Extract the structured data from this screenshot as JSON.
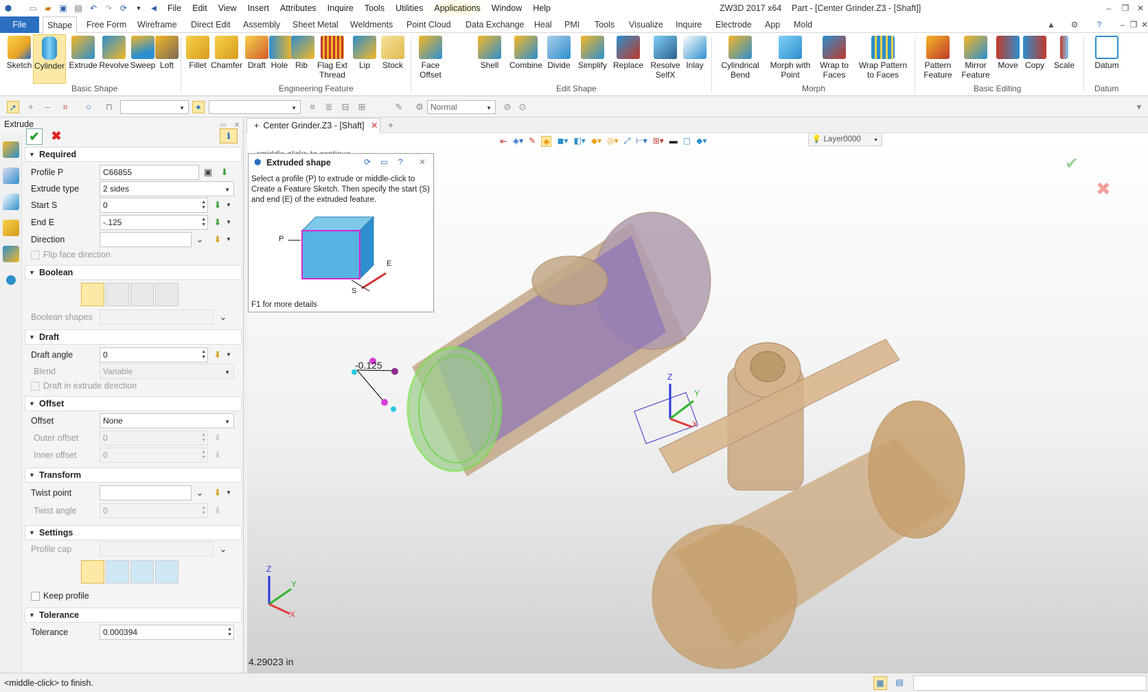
{
  "window": {
    "app_title": "ZW3D 2017  x64",
    "part_title": "Part - [Center Grinder.Z3 - [Shaft]]"
  },
  "menu": [
    "File",
    "Edit",
    "View",
    "Insert",
    "Attributes",
    "Inquire",
    "Tools",
    "Utilities",
    "Applications",
    "Window",
    "Help"
  ],
  "ribbon_tabs": [
    "File",
    "Shape",
    "Free Form",
    "Wireframe",
    "Direct Edit",
    "Assembly",
    "Sheet Metal",
    "Weldments",
    "Point Cloud",
    "Data Exchange",
    "Heal",
    "PMI",
    "Tools",
    "Visualize",
    "Inquire",
    "Electrode",
    "App",
    "Mold"
  ],
  "ribbon": {
    "basic_shape": {
      "label": "Basic Shape",
      "buttons": [
        "Sketch",
        "Cylinder",
        "Extrude",
        "Revolve",
        "Sweep",
        "Loft"
      ]
    },
    "engineering_feature": {
      "label": "Engineering Feature",
      "buttons": [
        "Fillet",
        "Chamfer",
        "Draft",
        "Hole",
        "Rib",
        "Flag Ext Thread",
        "Lip",
        "Stock"
      ]
    },
    "edit_shape": {
      "label": "Edit Shape",
      "buttons": [
        "Face Offset",
        "Shell",
        "Combine",
        "Divide",
        "Simplify",
        "Replace",
        "Resolve SelfX",
        "Inlay"
      ]
    },
    "morph": {
      "label": "Morph",
      "buttons": [
        "Cylindrical Bend",
        "Morph with Point",
        "Wrap to Faces",
        "Wrap Pattern to Faces"
      ]
    },
    "basic_editing": {
      "label": "Basic Editing",
      "buttons": [
        "Pattern Feature",
        "Mirror Feature",
        "Move",
        "Copy",
        "Scale"
      ]
    },
    "datum": {
      "label": "Datum",
      "buttons": [
        "Datum"
      ]
    }
  },
  "toolbar": {
    "render_mode": "Normal",
    "layer": "Layer0000"
  },
  "panel": {
    "title": "Extrude",
    "required": {
      "label": "Required",
      "profile_label": "Profile P",
      "profile": "C66855",
      "extrude_type_label": "Extrude type",
      "extrude_type": "2 sides",
      "start_label": "Start S",
      "start": "0",
      "end_label": "End E",
      "end": "-.125",
      "direction_label": "Direction",
      "direction": "",
      "flip_label": "Flip face direction"
    },
    "boolean": {
      "label": "Boolean",
      "shapes_label": "Boolean shapes"
    },
    "draft": {
      "label": "Draft",
      "angle_label": "Draft angle",
      "angle": "0",
      "blend_label": "Blend",
      "blend": "Variable",
      "in_dir_label": "Draft in extrude direction"
    },
    "offset": {
      "label": "Offset",
      "offset_label": "Offset",
      "offset": "None",
      "outer_label": "Outer offset",
      "outer": "0",
      "inner_label": "Inner offset",
      "inner": "0"
    },
    "transform": {
      "label": "Transform",
      "twist_point_label": "Twist point",
      "twist_angle_label": "Twist angle",
      "twist_angle": "0"
    },
    "settings": {
      "label": "Settings",
      "cap_label": "Profile cap",
      "keep_label": "Keep profile"
    },
    "tolerance": {
      "label": "Tolerance",
      "tol_label": "Tolerance",
      "tol": "0.000394"
    }
  },
  "doc_tab": "Center Grinder.Z3 - [Shaft]",
  "tooltip": {
    "hint": "<middle-click> to continue",
    "title": "Extruded shape",
    "body": "Select a profile (P) to extrude or middle-click to Create a Feature Sketch. Then specify the start (S) and end (E) of the extruded feature.",
    "footer": "F1 for more details",
    "p": "P",
    "e": "E",
    "s": "S"
  },
  "viewport": {
    "dimension": "-0.125",
    "measure": "4.29023 in",
    "axis_z": "Z",
    "axis_y": "Y",
    "axis_x": "X"
  },
  "status": "<middle-click> to finish."
}
